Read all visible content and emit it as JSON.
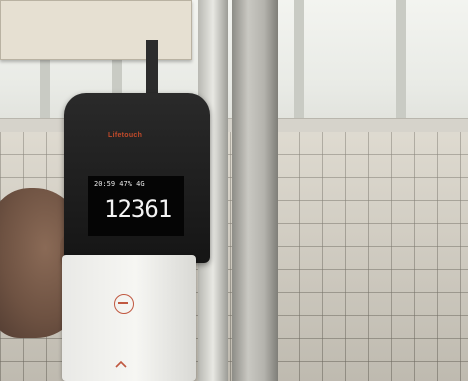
{
  "photo": {
    "description_visible_text": {
      "brand": "Lifetouch",
      "display_status": "20:59 47% 4G",
      "display_value": "12361"
    }
  },
  "icons": {
    "power": "power-button-icon",
    "chevron": "chevron-up-icon"
  },
  "colors": {
    "brand_red": "#c24a2a",
    "display_bg": "#050505",
    "display_text": "#f4f4f4"
  }
}
